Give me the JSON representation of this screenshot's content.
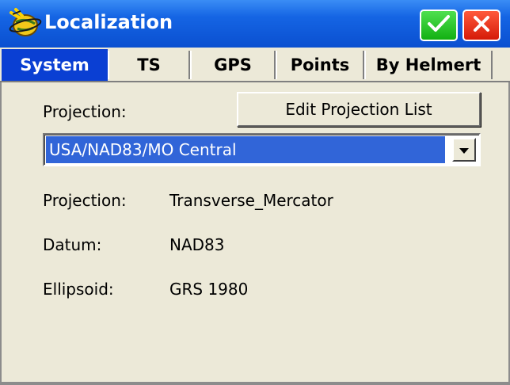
{
  "window": {
    "title": "Localization",
    "icons": {
      "app": "globe-satellite-icon",
      "ok": "checkmark-icon",
      "close": "close-icon"
    }
  },
  "tabs": [
    {
      "label": "System",
      "active": true
    },
    {
      "label": "TS",
      "active": false
    },
    {
      "label": "GPS",
      "active": false
    },
    {
      "label": "Points",
      "active": false
    },
    {
      "label": "By Helmert",
      "active": false
    }
  ],
  "system": {
    "projection_label": "Projection:",
    "edit_button_label": "Edit Projection List",
    "selected_projection": "USA/NAD83/MO Central",
    "details": {
      "projection_label": "Projection:",
      "projection_value": "Transverse_Mercator",
      "datum_label": "Datum:",
      "datum_value": "NAD83",
      "ellipsoid_label": "Ellipsoid:",
      "ellipsoid_value": "GRS 1980"
    }
  },
  "colors": {
    "titlebar": "#1565e4",
    "active_tab": "#0a3fd3",
    "selection": "#3165d8",
    "ok_button": "#12b012",
    "close_button": "#d51a08"
  }
}
